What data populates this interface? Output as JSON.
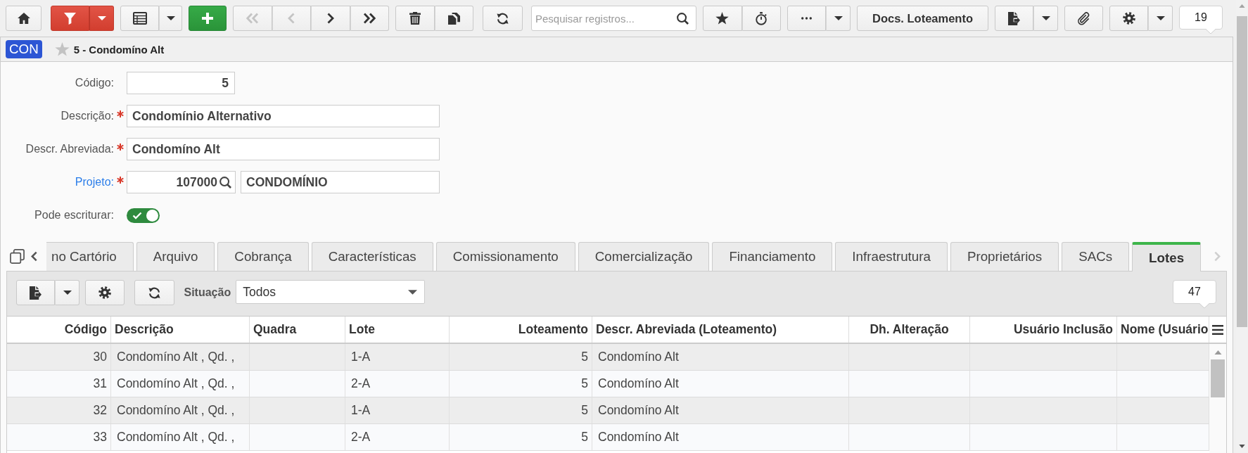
{
  "toolbar": {
    "nav_buttons": [
      {
        "disabled": true
      },
      {
        "disabled": true
      },
      {
        "disabled": false
      },
      {
        "disabled": false
      }
    ],
    "search": {
      "placeholder": "Pesquisar registros..."
    },
    "docs_button": "Docs. Loteamento",
    "record_count": "19"
  },
  "record": {
    "badge": "CON",
    "favorite": false,
    "title": "5 - Condomíno Alt"
  },
  "form": {
    "fields": [
      {
        "label": "Código:",
        "kind": "number",
        "required": false,
        "value": "5"
      },
      {
        "label": "Descrição:",
        "kind": "text",
        "required": true,
        "value": "Condomínio Alternativo"
      },
      {
        "label": "Descr. Abreviada:",
        "kind": "text",
        "required": true,
        "value": "Condomíno Alt"
      },
      {
        "label": "Projeto:",
        "kind": "lookup",
        "required": true,
        "value": "107000",
        "description": "CONDOMÍNIO"
      },
      {
        "label": "Pode escriturar:",
        "kind": "toggle",
        "required": false,
        "on": true
      }
    ]
  },
  "tab_strip": {
    "scroll_buttons": [
      {
        "disabled": false
      },
      {
        "disabled": true
      }
    ],
    "tabs": [
      {
        "label": "no Cartório",
        "selected": false
      },
      {
        "label": "Arquivo",
        "selected": false
      },
      {
        "label": "Cobrança",
        "selected": false
      },
      {
        "label": "Características",
        "selected": false
      },
      {
        "label": "Comissionamento",
        "selected": false
      },
      {
        "label": "Comercialização",
        "selected": false
      },
      {
        "label": "Financiamento",
        "selected": false
      },
      {
        "label": "Infraestrutura",
        "selected": false
      },
      {
        "label": "Proprietários",
        "selected": false
      },
      {
        "label": "SACs",
        "selected": false
      },
      {
        "label": "Lotes",
        "selected": true
      }
    ]
  },
  "grid": {
    "filter": {
      "label": "Situação",
      "value": "Todos"
    },
    "record_count": "47",
    "columns": [
      {
        "label": "Código"
      },
      {
        "label": "Descrição"
      },
      {
        "label": "Quadra"
      },
      {
        "label": "Lote"
      },
      {
        "label": "Loteamento"
      },
      {
        "label": "Descr. Abreviada (Loteamento)"
      },
      {
        "label": "Dh. Alteração"
      },
      {
        "label": "Usuário Inclusão"
      },
      {
        "label": "Nome (Usuário"
      }
    ],
    "rows": [
      {
        "codigo": "30",
        "descricao": "Condomíno Alt , Qd. ,",
        "lote": "1-A",
        "loteamento": "5",
        "descr_abreviada": "Condomíno Alt"
      },
      {
        "codigo": "31",
        "descricao": "Condomíno Alt , Qd. ,",
        "lote": "2-A",
        "loteamento": "5",
        "descr_abreviada": "Condomíno Alt"
      },
      {
        "codigo": "32",
        "descricao": "Condomíno Alt , Qd. ,",
        "lote": "1-A",
        "loteamento": "5",
        "descr_abreviada": "Condomíno Alt"
      },
      {
        "codigo": "33",
        "descricao": "Condomíno Alt , Qd. ,",
        "lote": "2-A",
        "loteamento": "5",
        "descr_abreviada": "Condomíno Alt"
      }
    ]
  }
}
